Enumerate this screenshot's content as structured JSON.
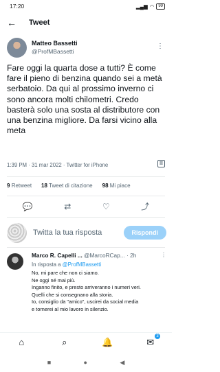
{
  "status_bar": {
    "time": "17:20",
    "signal": "▂▄▆",
    "wifi": "◠",
    "battery": "99"
  },
  "app_bar": {
    "back_icon": "←",
    "title": "Tweet"
  },
  "tweet": {
    "display_name": "Matteo Bassetti",
    "handle": "@ProfMBassetti",
    "more_icon": "⋮",
    "text": "Fare oggi la quarta dose a tutti? È come fare il pieno di benzina quando sei a metà serbatoio. Da qui al prossimo inverno ci sono ancora molti chilometri. Credo basterà solo una sosta al distributore con una benzina migliore. Da farsi vicino alla meta",
    "meta": "1:39 PM · 31 mar 2022 · Twitter for iPhone",
    "stats": [
      {
        "count": "9",
        "label": "Retweet"
      },
      {
        "count": "18",
        "label": "Tweet di citazione"
      },
      {
        "count": "98",
        "label": "Mi piace"
      }
    ]
  },
  "actions": {
    "reply": "💬",
    "retweet": "⇄",
    "like": "♡",
    "share": "⤴"
  },
  "reply_box": {
    "placeholder": "Twitta la tua risposta",
    "button": "Rispondi"
  },
  "reply": {
    "name": "Marco R. Capelli ...",
    "handle": "@MarcoRCap...",
    "time": "· 2h",
    "more_icon": "⋮",
    "in_reply_prefix": "In risposta a",
    "in_reply_handle": "@ProfMBassetti",
    "lines": [
      "No, mi pare che non ci siamo.",
      "Ne oggi né mai più.",
      "Inganno finito, e presto arriveranno i numeri veri.",
      "Quelli che si consegnano alla storia.",
      "Io, consiglio da \"amico\", uscirei da social media",
      "e tornerei al mio lavoro in silenzio."
    ]
  },
  "bottom_nav": {
    "home": "⌂",
    "search": "⌕",
    "notifications": "🔔",
    "messages": "✉",
    "messages_badge": "3"
  },
  "system_nav": {
    "recents": "■",
    "home": "●",
    "back": "◀"
  }
}
